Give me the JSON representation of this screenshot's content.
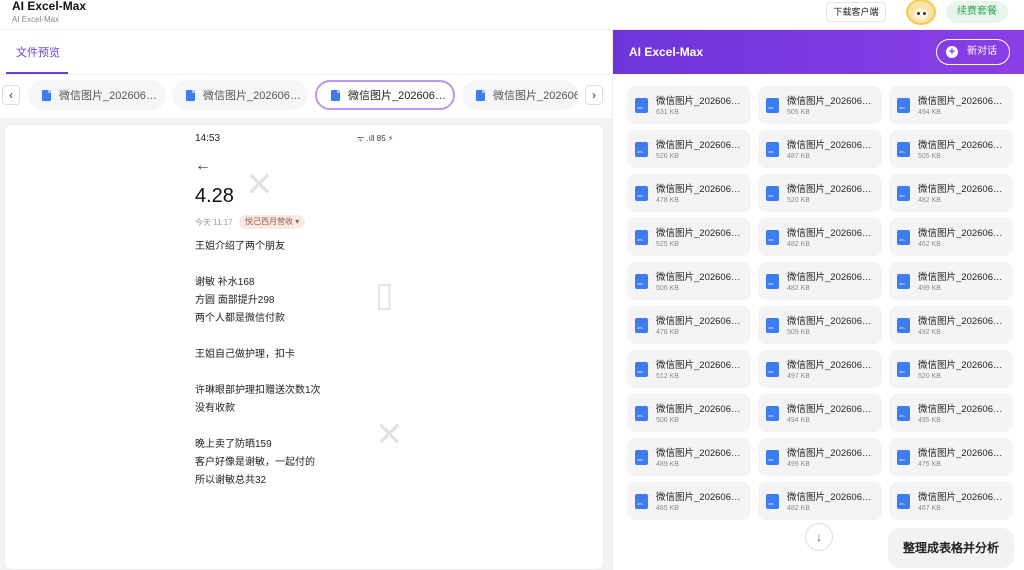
{
  "header": {
    "app_title": "AI Excel-Max",
    "app_subtitle": "AI Excel-Max",
    "download_label": "下载客户端",
    "renew_label": "续费套餐"
  },
  "left": {
    "tab_label": "文件预览",
    "prev_arrow": "‹",
    "next_arrow": "›",
    "file_tabs": [
      {
        "label": "微信图片_202606…"
      },
      {
        "label": "微信图片_202606…"
      },
      {
        "label": "微信图片_202606…"
      },
      {
        "label": "微信图片_202606"
      }
    ]
  },
  "preview": {
    "time": "14:53",
    "status": "ᯤ .ıll 85 ⚡",
    "back": "←",
    "title": "4.28",
    "meta_time": "今天 11:17",
    "tag": "悦己西月营收 ▾",
    "lines": [
      "王姐介绍了两个朋友",
      "谢敏 补水168",
      "方圆 面部提升298",
      "两个人都是微信付款",
      "王姐自己做护理，扣卡",
      "许琳眼部护理扣赠送次数1次",
      "没有收款",
      "晚上卖了防晒159",
      "客户好像是谢敏，一起付的",
      "所以谢敏总共32"
    ]
  },
  "right": {
    "title": "AI Excel-Max",
    "new_chat_label": "新对话",
    "files": [
      {
        "name": "微信图片_202606…",
        "size": "631 KB"
      },
      {
        "name": "微信图片_202606…",
        "size": "505 KB"
      },
      {
        "name": "微信图片_202606…",
        "size": "494 KB"
      },
      {
        "name": "微信图片_202606…",
        "size": "520 KB"
      },
      {
        "name": "微信图片_202606…",
        "size": "487 KB"
      },
      {
        "name": "微信图片_202606…",
        "size": "505 KB"
      },
      {
        "name": "微信图片_202606…",
        "size": "478 KB"
      },
      {
        "name": "微信图片_202606…",
        "size": "520 KB"
      },
      {
        "name": "微信图片_202606…",
        "size": "482 KB"
      },
      {
        "name": "微信图片_202606…",
        "size": "525 KB"
      },
      {
        "name": "微信图片_202606…",
        "size": "482 KB"
      },
      {
        "name": "微信图片_202606…",
        "size": "462 KB"
      },
      {
        "name": "微信图片_202606…",
        "size": "506 KB"
      },
      {
        "name": "微信图片_202606…",
        "size": "482 KB"
      },
      {
        "name": "微信图片_202606…",
        "size": "499 KB"
      },
      {
        "name": "微信图片_202606…",
        "size": "478 KB"
      },
      {
        "name": "微信图片_202606…",
        "size": "509 KB"
      },
      {
        "name": "微信图片_202606…",
        "size": "492 KB"
      },
      {
        "name": "微信图片_202606…",
        "size": "512 KB"
      },
      {
        "name": "微信图片_202606…",
        "size": "497 KB"
      },
      {
        "name": "微信图片_202606…",
        "size": "520 KB"
      },
      {
        "name": "微信图片_202606…",
        "size": "500 KB"
      },
      {
        "name": "微信图片_202606…",
        "size": "494 KB"
      },
      {
        "name": "微信图片_202606…",
        "size": "495 KB"
      },
      {
        "name": "微信图片_202606…",
        "size": "489 KB"
      },
      {
        "name": "微信图片_202606…",
        "size": "499 KB"
      },
      {
        "name": "微信图片_202606…",
        "size": "475 KB"
      },
      {
        "name": "微信图片_202606…",
        "size": "485 KB"
      },
      {
        "name": "微信图片_202606…",
        "size": "482 KB"
      },
      {
        "name": "微信图片_202606…",
        "size": "467 KB"
      }
    ],
    "scroll_down": "↓",
    "analyze_label": "整理成表格并分析"
  }
}
